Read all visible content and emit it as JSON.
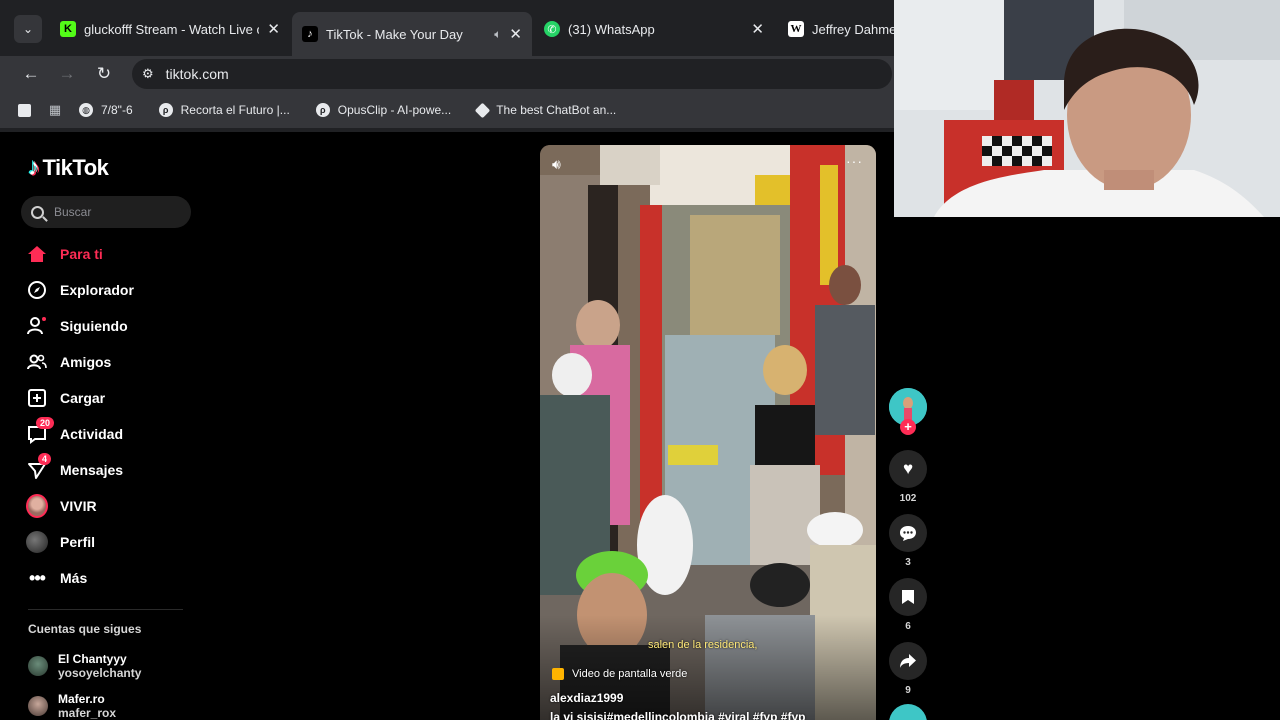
{
  "browser": {
    "tabs": [
      {
        "title": "gluckofff Stream - Watch Live o",
        "favicon": "K",
        "favicon_color": "#53fc18",
        "active": false
      },
      {
        "title": "TikTok - Make Your Day",
        "favicon": "♪",
        "favicon_color": "#000000",
        "active": true
      },
      {
        "title": "(31) WhatsApp",
        "favicon": "✆",
        "favicon_color": "#25d366",
        "active": false
      },
      {
        "title": "Jeffrey Dahmer",
        "favicon": "W",
        "favicon_color": "#ffffff",
        "active": false
      }
    ],
    "url": "tiktok.com",
    "bookmarks": [
      {
        "label": "7/8\"-6"
      },
      {
        "label": "Recorta el Futuro |..."
      },
      {
        "label": "OpusClip - AI-powe..."
      },
      {
        "label": "The best ChatBot an..."
      }
    ]
  },
  "tiktok": {
    "logo_text": "TikTok",
    "search_placeholder": "Buscar",
    "nav": [
      {
        "label": "Para ti",
        "icon": "home-icon",
        "active": true
      },
      {
        "label": "Explorador",
        "icon": "compass-icon"
      },
      {
        "label": "Siguiendo",
        "icon": "following-icon"
      },
      {
        "label": "Amigos",
        "icon": "friends-icon"
      },
      {
        "label": "Cargar",
        "icon": "upload-icon"
      },
      {
        "label": "Actividad",
        "icon": "activity-icon",
        "badge": "20"
      },
      {
        "label": "Mensajes",
        "icon": "messages-icon",
        "badge": "4"
      },
      {
        "label": "VIVIR",
        "icon": "live-avatar"
      },
      {
        "label": "Perfil",
        "icon": "profile-avatar"
      },
      {
        "label": "Más",
        "icon": "more-icon"
      }
    ],
    "following_title": "Cuentas que sigues",
    "following": [
      {
        "name": "El Chantyyy",
        "handle": "yosoyelchanty"
      },
      {
        "name": "Mafer.ro",
        "handle": "mafer_rox"
      }
    ],
    "video": {
      "caption": "salen de la residencia,",
      "green_screen_label": "Video de pantalla verde",
      "author": "alexdiaz1999",
      "description": "la vi sisisi#medellincolombia #viral #fyp #fyp",
      "likes": "102",
      "comments": "3",
      "saves": "6",
      "shares": "9"
    }
  },
  "colors": {
    "accent": "#fe2c55",
    "chrome_bg": "#202124",
    "toolbar_bg": "#35363a"
  }
}
